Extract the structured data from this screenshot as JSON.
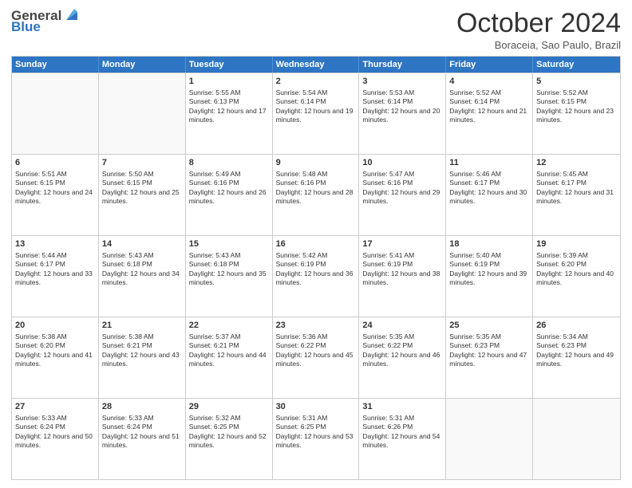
{
  "header": {
    "logo": {
      "general": "General",
      "blue": "Blue"
    },
    "title": "October 2024",
    "location": "Boraceia, Sao Paulo, Brazil"
  },
  "days_of_week": [
    "Sunday",
    "Monday",
    "Tuesday",
    "Wednesday",
    "Thursday",
    "Friday",
    "Saturday"
  ],
  "weeks": [
    [
      {
        "day": "",
        "sunrise": "",
        "sunset": "",
        "daylight": ""
      },
      {
        "day": "",
        "sunrise": "",
        "sunset": "",
        "daylight": ""
      },
      {
        "day": "1",
        "sunrise": "Sunrise: 5:55 AM",
        "sunset": "Sunset: 6:13 PM",
        "daylight": "Daylight: 12 hours and 17 minutes."
      },
      {
        "day": "2",
        "sunrise": "Sunrise: 5:54 AM",
        "sunset": "Sunset: 6:14 PM",
        "daylight": "Daylight: 12 hours and 19 minutes."
      },
      {
        "day": "3",
        "sunrise": "Sunrise: 5:53 AM",
        "sunset": "Sunset: 6:14 PM",
        "daylight": "Daylight: 12 hours and 20 minutes."
      },
      {
        "day": "4",
        "sunrise": "Sunrise: 5:52 AM",
        "sunset": "Sunset: 6:14 PM",
        "daylight": "Daylight: 12 hours and 21 minutes."
      },
      {
        "day": "5",
        "sunrise": "Sunrise: 5:52 AM",
        "sunset": "Sunset: 6:15 PM",
        "daylight": "Daylight: 12 hours and 23 minutes."
      }
    ],
    [
      {
        "day": "6",
        "sunrise": "Sunrise: 5:51 AM",
        "sunset": "Sunset: 6:15 PM",
        "daylight": "Daylight: 12 hours and 24 minutes."
      },
      {
        "day": "7",
        "sunrise": "Sunrise: 5:50 AM",
        "sunset": "Sunset: 6:15 PM",
        "daylight": "Daylight: 12 hours and 25 minutes."
      },
      {
        "day": "8",
        "sunrise": "Sunrise: 5:49 AM",
        "sunset": "Sunset: 6:16 PM",
        "daylight": "Daylight: 12 hours and 26 minutes."
      },
      {
        "day": "9",
        "sunrise": "Sunrise: 5:48 AM",
        "sunset": "Sunset: 6:16 PM",
        "daylight": "Daylight: 12 hours and 28 minutes."
      },
      {
        "day": "10",
        "sunrise": "Sunrise: 5:47 AM",
        "sunset": "Sunset: 6:16 PM",
        "daylight": "Daylight: 12 hours and 29 minutes."
      },
      {
        "day": "11",
        "sunrise": "Sunrise: 5:46 AM",
        "sunset": "Sunset: 6:17 PM",
        "daylight": "Daylight: 12 hours and 30 minutes."
      },
      {
        "day": "12",
        "sunrise": "Sunrise: 5:45 AM",
        "sunset": "Sunset: 6:17 PM",
        "daylight": "Daylight: 12 hours and 31 minutes."
      }
    ],
    [
      {
        "day": "13",
        "sunrise": "Sunrise: 5:44 AM",
        "sunset": "Sunset: 6:17 PM",
        "daylight": "Daylight: 12 hours and 33 minutes."
      },
      {
        "day": "14",
        "sunrise": "Sunrise: 5:43 AM",
        "sunset": "Sunset: 6:18 PM",
        "daylight": "Daylight: 12 hours and 34 minutes."
      },
      {
        "day": "15",
        "sunrise": "Sunrise: 5:43 AM",
        "sunset": "Sunset: 6:18 PM",
        "daylight": "Daylight: 12 hours and 35 minutes."
      },
      {
        "day": "16",
        "sunrise": "Sunrise: 5:42 AM",
        "sunset": "Sunset: 6:19 PM",
        "daylight": "Daylight: 12 hours and 36 minutes."
      },
      {
        "day": "17",
        "sunrise": "Sunrise: 5:41 AM",
        "sunset": "Sunset: 6:19 PM",
        "daylight": "Daylight: 12 hours and 38 minutes."
      },
      {
        "day": "18",
        "sunrise": "Sunrise: 5:40 AM",
        "sunset": "Sunset: 6:19 PM",
        "daylight": "Daylight: 12 hours and 39 minutes."
      },
      {
        "day": "19",
        "sunrise": "Sunrise: 5:39 AM",
        "sunset": "Sunset: 6:20 PM",
        "daylight": "Daylight: 12 hours and 40 minutes."
      }
    ],
    [
      {
        "day": "20",
        "sunrise": "Sunrise: 5:38 AM",
        "sunset": "Sunset: 6:20 PM",
        "daylight": "Daylight: 12 hours and 41 minutes."
      },
      {
        "day": "21",
        "sunrise": "Sunrise: 5:38 AM",
        "sunset": "Sunset: 6:21 PM",
        "daylight": "Daylight: 12 hours and 43 minutes."
      },
      {
        "day": "22",
        "sunrise": "Sunrise: 5:37 AM",
        "sunset": "Sunset: 6:21 PM",
        "daylight": "Daylight: 12 hours and 44 minutes."
      },
      {
        "day": "23",
        "sunrise": "Sunrise: 5:36 AM",
        "sunset": "Sunset: 6:22 PM",
        "daylight": "Daylight: 12 hours and 45 minutes."
      },
      {
        "day": "24",
        "sunrise": "Sunrise: 5:35 AM",
        "sunset": "Sunset: 6:22 PM",
        "daylight": "Daylight: 12 hours and 46 minutes."
      },
      {
        "day": "25",
        "sunrise": "Sunrise: 5:35 AM",
        "sunset": "Sunset: 6:23 PM",
        "daylight": "Daylight: 12 hours and 47 minutes."
      },
      {
        "day": "26",
        "sunrise": "Sunrise: 5:34 AM",
        "sunset": "Sunset: 6:23 PM",
        "daylight": "Daylight: 12 hours and 49 minutes."
      }
    ],
    [
      {
        "day": "27",
        "sunrise": "Sunrise: 5:33 AM",
        "sunset": "Sunset: 6:24 PM",
        "daylight": "Daylight: 12 hours and 50 minutes."
      },
      {
        "day": "28",
        "sunrise": "Sunrise: 5:33 AM",
        "sunset": "Sunset: 6:24 PM",
        "daylight": "Daylight: 12 hours and 51 minutes."
      },
      {
        "day": "29",
        "sunrise": "Sunrise: 5:32 AM",
        "sunset": "Sunset: 6:25 PM",
        "daylight": "Daylight: 12 hours and 52 minutes."
      },
      {
        "day": "30",
        "sunrise": "Sunrise: 5:31 AM",
        "sunset": "Sunset: 6:25 PM",
        "daylight": "Daylight: 12 hours and 53 minutes."
      },
      {
        "day": "31",
        "sunrise": "Sunrise: 5:31 AM",
        "sunset": "Sunset: 6:26 PM",
        "daylight": "Daylight: 12 hours and 54 minutes."
      },
      {
        "day": "",
        "sunrise": "",
        "sunset": "",
        "daylight": ""
      },
      {
        "day": "",
        "sunrise": "",
        "sunset": "",
        "daylight": ""
      }
    ]
  ]
}
